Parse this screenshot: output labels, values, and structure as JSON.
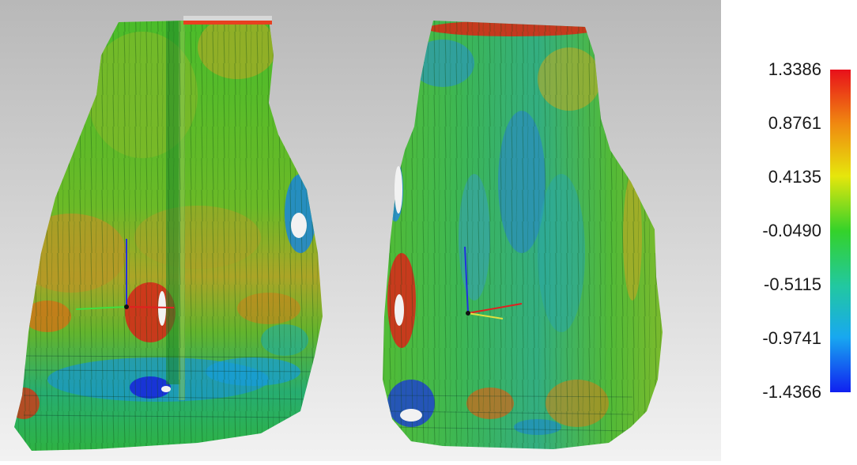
{
  "legend": {
    "ticks": [
      "1.3386",
      "0.8761",
      "0.4135",
      "-0.0490",
      "-0.5115",
      "-0.9741",
      "-1.4366"
    ],
    "colors": [
      "#e8101a",
      "#f08a10",
      "#e6e60c",
      "#34d22a",
      "#22c8a0",
      "#18a8f0",
      "#1020f0"
    ]
  },
  "viewport": {
    "background_top": "#b4b4b4",
    "background_bottom": "#f0f0f0",
    "objects": [
      "left-scan",
      "right-scan"
    ]
  }
}
